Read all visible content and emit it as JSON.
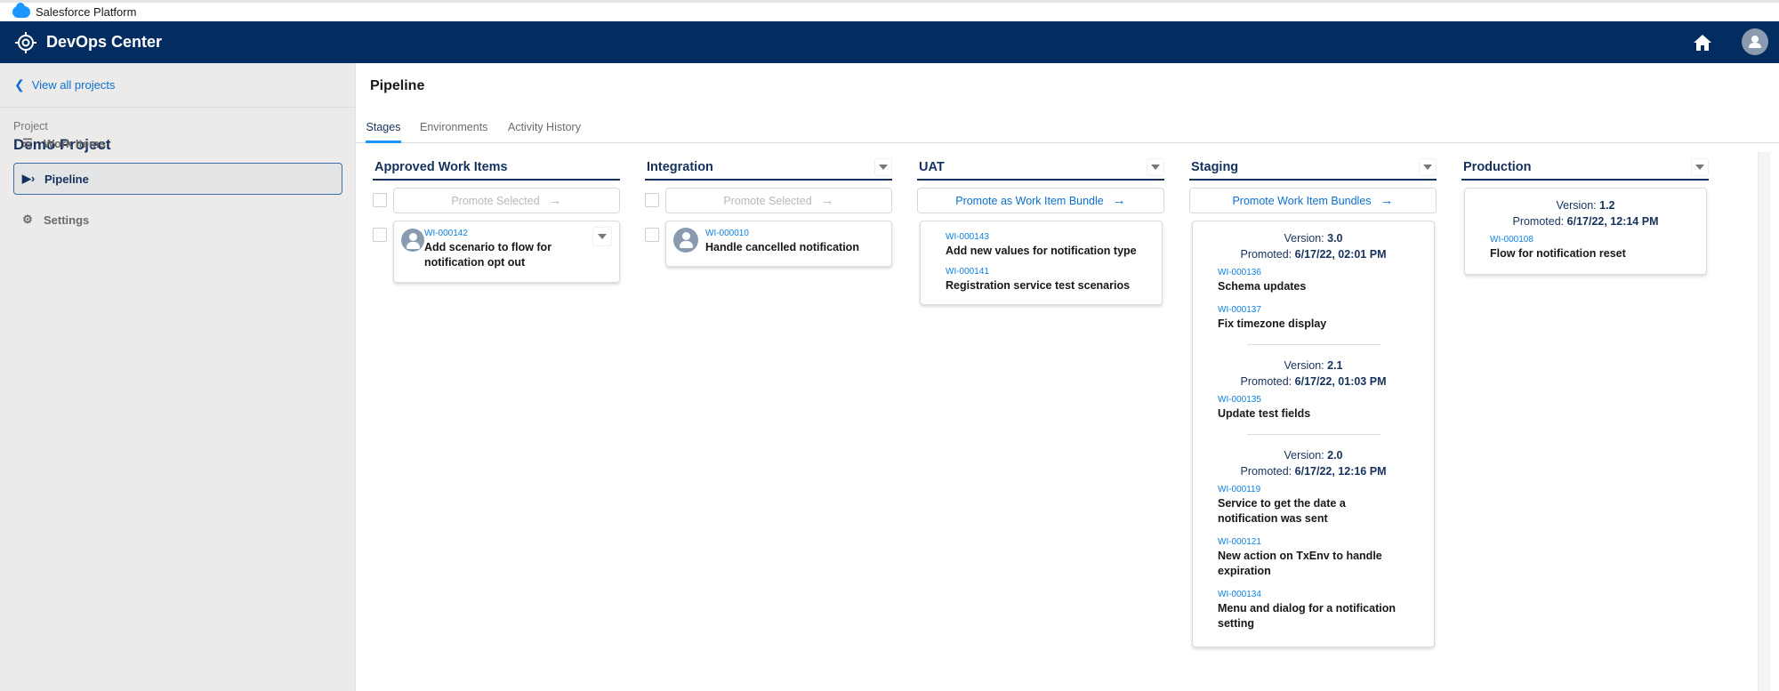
{
  "platform": {
    "label": "Salesforce Platform"
  },
  "app": {
    "title": "DevOps Center",
    "home_icon": "home-icon",
    "avatar_icon": "user-avatar-icon"
  },
  "sidebar": {
    "back_link": "View all projects",
    "project_label": "Project",
    "project_name": "Demo Project",
    "items": [
      {
        "label": "Work Items",
        "icon": "work-items-list-icon",
        "active": false
      },
      {
        "label": "Pipeline",
        "icon": "pipeline-icon",
        "active": true
      },
      {
        "label": "Settings",
        "icon": "gear-icon",
        "active": false
      }
    ]
  },
  "main": {
    "title": "Pipeline",
    "tabs": [
      {
        "label": "Stages",
        "active": true
      },
      {
        "label": "Environments",
        "active": false
      },
      {
        "label": "Activity History",
        "active": false
      }
    ],
    "stages": [
      {
        "name": "Approved Work Items",
        "action": "Promote Selected",
        "action_enabled": false,
        "items": [
          {
            "id": "WI-000142",
            "title": "Add scenario to flow for notification opt out"
          }
        ]
      },
      {
        "name": "Integration",
        "action": "Promote Selected",
        "action_enabled": false,
        "items": [
          {
            "id": "WI-000010",
            "title": "Handle cancelled notification"
          }
        ]
      },
      {
        "name": "UAT",
        "action": "Promote as Work Item Bundle",
        "action_enabled": true,
        "items": [
          {
            "id": "WI-000143",
            "title": "Add new values for notification type"
          },
          {
            "id": "WI-000141",
            "title": "Registration service test scenarios"
          }
        ]
      },
      {
        "name": "Staging",
        "action": "Promote Work Item Bundles",
        "action_enabled": true,
        "bundles": [
          {
            "version_label": "Version:",
            "version": "3.0",
            "promoted_label": "Promoted:",
            "promoted": "6/17/22, 02:01 PM",
            "items": [
              {
                "id": "WI-000136",
                "title": "Schema updates"
              },
              {
                "id": "WI-000137",
                "title": "Fix timezone display"
              }
            ]
          },
          {
            "version_label": "Version:",
            "version": "2.1",
            "promoted_label": "Promoted:",
            "promoted": "6/17/22, 01:03 PM",
            "items": [
              {
                "id": "WI-000135",
                "title": "Update test fields"
              }
            ]
          },
          {
            "version_label": "Version:",
            "version": "2.0",
            "promoted_label": "Promoted:",
            "promoted": "6/17/22, 12:16 PM",
            "items": [
              {
                "id": "WI-000119",
                "title": "Service to get the date a notification was sent"
              },
              {
                "id": "WI-000121",
                "title": "New action on TxEnv to handle expiration"
              },
              {
                "id": "WI-000134",
                "title": "Menu and dialog for a notification setting"
              }
            ]
          }
        ]
      },
      {
        "name": "Production",
        "bundles": [
          {
            "version_label": "Version:",
            "version": "1.2",
            "promoted_label": "Promoted:",
            "promoted": "6/17/22, 12:14 PM",
            "items": [
              {
                "id": "WI-000108",
                "title": "Flow for notification reset"
              }
            ]
          }
        ]
      }
    ]
  }
}
